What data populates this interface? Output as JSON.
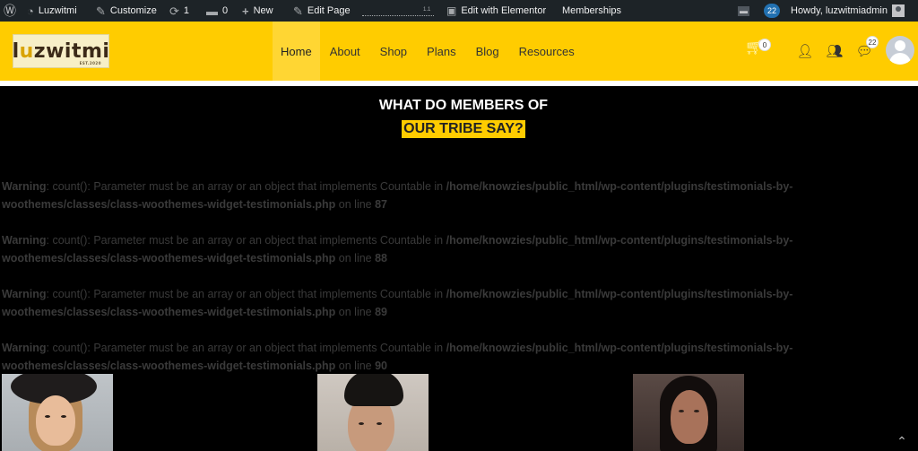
{
  "adminbar": {
    "site_name": "Luzwitmi",
    "customize": "Customize",
    "updates_count": "1",
    "comments_count": "0",
    "new_label": "New",
    "edit_page": "Edit Page",
    "dots_text": "1.1",
    "edit_elementor": "Edit with Elementor",
    "memberships": "Memberships",
    "notifications_count": "22",
    "howdy": "Howdy, luzwitmiadmin"
  },
  "header": {
    "logo_text": "luzwitmi",
    "logo_sub": "EST.2020",
    "nav": [
      "Home",
      "About",
      "Shop",
      "Plans",
      "Blog",
      "Resources"
    ],
    "active_nav": "Home",
    "cart_count": "0",
    "messages_count": "22",
    "brand_color": "#ffcc00"
  },
  "content": {
    "heading_line1": "WHAT DO MEMBERS OF",
    "heading_line2": "OUR TRIBE SAY?",
    "warnings": [
      {
        "label": "Warning",
        "message": ": count(): Parameter must be an array or an object that implements Countable in ",
        "path": "/home/knowzies/public_html/wp-content/plugins/testimonials-by-woothemes/classes/class-woothemes-widget-testimonials.php",
        "on_line": " on line ",
        "line": "87"
      },
      {
        "label": "Warning",
        "message": ": count(): Parameter must be an array or an object that implements Countable in ",
        "path": "/home/knowzies/public_html/wp-content/plugins/testimonials-by-woothemes/classes/class-woothemes-widget-testimonials.php",
        "on_line": " on line ",
        "line": "88"
      },
      {
        "label": "Warning",
        "message": ": count(): Parameter must be an array or an object that implements Countable in ",
        "path": "/home/knowzies/public_html/wp-content/plugins/testimonials-by-woothemes/classes/class-woothemes-widget-testimonials.php",
        "on_line": " on line ",
        "line": "89"
      },
      {
        "label": "Warning",
        "message": ": count(): Parameter must be an array or an object that implements Countable in ",
        "path": "/home/knowzies/public_html/wp-content/plugins/testimonials-by-woothemes/classes/class-woothemes-widget-testimonials.php",
        "on_line": " on line ",
        "line": "90"
      }
    ]
  },
  "icons": {
    "wordpress": "wordpress-icon",
    "site": "dashboard-icon",
    "customize": "brush-icon",
    "updates": "refresh-icon",
    "comments": "comment-icon",
    "new": "plus-icon",
    "edit": "pencil-icon",
    "elementor": "elementor-icon",
    "cart": "cart-icon",
    "user": "user-check-icon",
    "groups": "groups-icon",
    "messages": "chat-icon",
    "scroll_top": "chevron-up-icon"
  }
}
